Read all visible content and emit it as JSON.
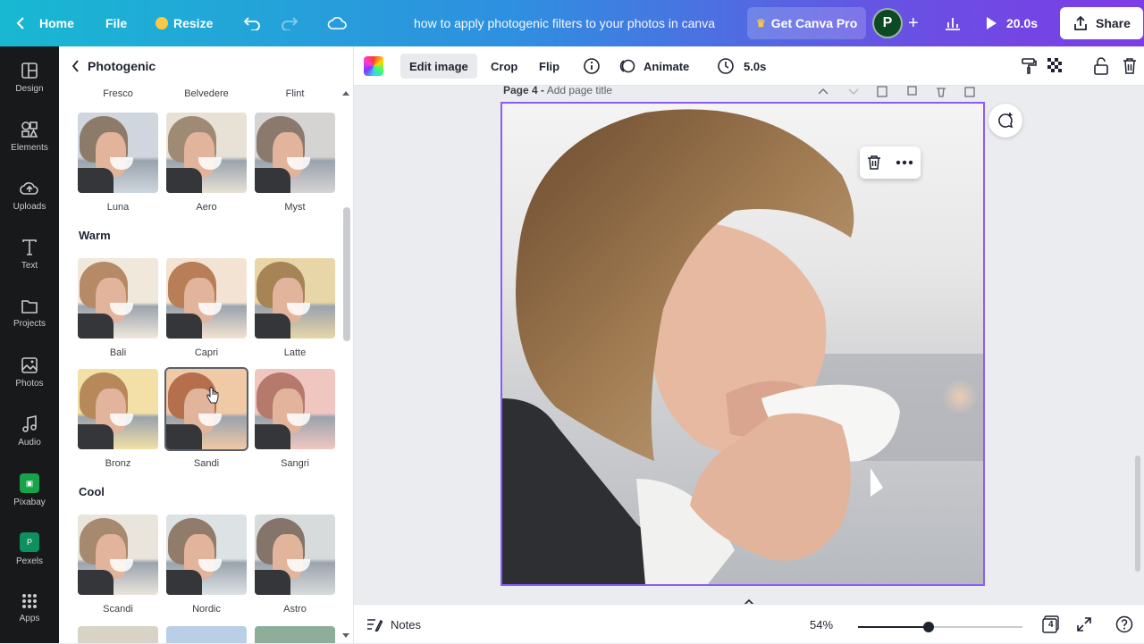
{
  "topbar": {
    "home_label": "Home",
    "file_label": "File",
    "resize_label": "Resize",
    "doc_title": "how to apply photogenic filters to your photos  in canva",
    "get_pro_label": "Get Canva Pro",
    "avatar_letter": "P",
    "duration_label": "20.0s",
    "share_label": "Share"
  },
  "sidebar": {
    "items": [
      {
        "label": "Design",
        "icon": "layout-icon"
      },
      {
        "label": "Elements",
        "icon": "shapes-icon"
      },
      {
        "label": "Uploads",
        "icon": "cloud-upload-icon"
      },
      {
        "label": "Text",
        "icon": "text-icon"
      },
      {
        "label": "Projects",
        "icon": "folder-icon"
      },
      {
        "label": "Photos",
        "icon": "image-icon"
      },
      {
        "label": "Audio",
        "icon": "music-icon"
      },
      {
        "label": "Pixabay",
        "icon": "pixabay-icon"
      },
      {
        "label": "Pexels",
        "icon": "pexels-icon"
      },
      {
        "label": "Apps",
        "icon": "grid-icon"
      }
    ]
  },
  "panel": {
    "title": "Photogenic",
    "top_labels": [
      "Fresco",
      "Belvedere",
      "Flint"
    ],
    "row1": [
      "Luna",
      "Aero",
      "Myst"
    ],
    "sections": [
      {
        "title": "Warm",
        "rows": [
          [
            "Bali",
            "Capri",
            "Latte"
          ],
          [
            "Bronz",
            "Sandi",
            "Sangri"
          ]
        ]
      },
      {
        "title": "Cool",
        "rows": [
          [
            "Scandi",
            "Nordic",
            "Astro"
          ]
        ]
      }
    ],
    "selected": "Sandi"
  },
  "toolbar": {
    "edit_image_label": "Edit image",
    "crop_label": "Crop",
    "flip_label": "Flip",
    "animate_label": "Animate",
    "time_label": "5.0s"
  },
  "canvas": {
    "page_label": "Page 4 -",
    "page_title_placeholder": "Add page title"
  },
  "bottombar": {
    "notes_label": "Notes",
    "zoom_label": "54%",
    "zoom_fraction": 0.43,
    "page_count": "4"
  },
  "colors": {
    "selection": "#8b5cf6",
    "avatar_bg": "#0d4a24"
  }
}
